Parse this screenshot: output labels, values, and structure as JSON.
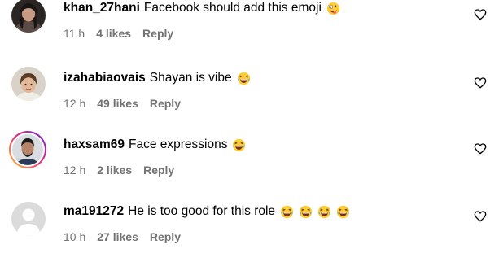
{
  "comments": [
    {
      "username": "khan_27hani",
      "text": "Facebook should add this emoji",
      "emojis": [
        "zany-face-emoji"
      ],
      "time": "11 h",
      "likes": "4 likes",
      "reply": "Reply",
      "avatar": "profile-photo-woman"
    },
    {
      "username": "izahabiaovais",
      "text": "Shayan is vibe",
      "emojis": [
        "laughing-emoji"
      ],
      "time": "12 h",
      "likes": "49 likes",
      "reply": "Reply",
      "avatar": "profile-photo-child"
    },
    {
      "username": "haxsam69",
      "text": "Face expressions",
      "emojis": [
        "laughing-emoji"
      ],
      "time": "12 h",
      "likes": "2 likes",
      "reply": "Reply",
      "avatar": "profile-photo-man-story-ring"
    },
    {
      "username": "ma191272",
      "text": "He is too good for this role",
      "emojis": [
        "laughing-emoji",
        "laughing-emoji",
        "laughing-emoji",
        "laughing-emoji"
      ],
      "time": "10 h",
      "likes": "27 likes",
      "reply": "Reply",
      "avatar": "default-avatar"
    }
  ],
  "icons": {
    "like": "heart-outline-icon"
  },
  "colors": {
    "text": "#000000",
    "meta": "#737373",
    "story_ring_start": "#f9ce34",
    "story_ring_mid": "#ee2a7b",
    "story_ring_end": "#6228d7",
    "default_avatar_bg": "#dbdbdb",
    "default_avatar_fg": "#ffffff"
  }
}
